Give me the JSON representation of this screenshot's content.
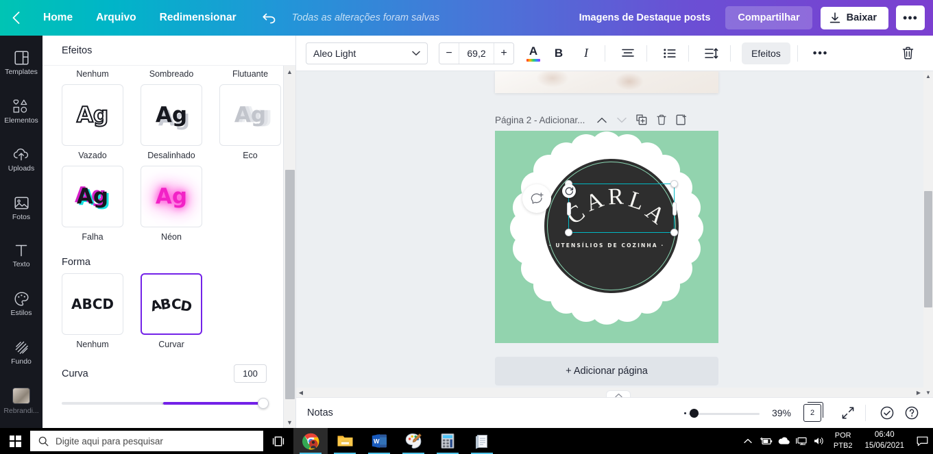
{
  "topbar": {
    "back_icon": "chevron-left-icon",
    "home": "Home",
    "arquivo": "Arquivo",
    "redimensionar": "Redimensionar",
    "undo_icon": "undo-arrow-icon",
    "save_status": "Todas as alterações foram salvas",
    "doc_name": "Imagens de Destaque posts",
    "share": "Compartilhar",
    "download": "Baixar",
    "download_icon": "download-icon",
    "more_icon": "ellipsis-icon",
    "more": "•••",
    "gradient_from": "#00c4b4",
    "gradient_to": "#7b3fd0"
  },
  "rail": {
    "items": [
      {
        "label": "Templates",
        "icon": "templates-icon"
      },
      {
        "label": "Elementos",
        "icon": "shapes-icon"
      },
      {
        "label": "Uploads",
        "icon": "cloud-upload-icon"
      },
      {
        "label": "Fotos",
        "icon": "photo-icon"
      },
      {
        "label": "Texto",
        "icon": "text-t-icon"
      },
      {
        "label": "Estilos",
        "icon": "palette-icon"
      },
      {
        "label": "Fundo",
        "icon": "background-hatch-icon"
      },
      {
        "label": "Rebrandi...",
        "icon": "brand-thumbnail-icon"
      }
    ]
  },
  "panel": {
    "title": "Efeitos",
    "top_captions": [
      "Nenhum",
      "Sombreado",
      "Flutuante"
    ],
    "effects_row1": [
      {
        "label": "Vazado",
        "sample": "Ag",
        "style": "vazado"
      },
      {
        "label": "Desalinhado",
        "sample": "Ag",
        "style": "desal"
      },
      {
        "label": "Eco",
        "sample": "Ag",
        "style": "eco"
      }
    ],
    "effects_row2": [
      {
        "label": "Falha",
        "sample": "Ag",
        "style": "falha"
      },
      {
        "label": "Néon",
        "sample": "Ag",
        "style": "neon"
      }
    ],
    "shape_title": "Forma",
    "shapes": [
      {
        "label": "Nenhum",
        "sample": "ABCD",
        "selected": false
      },
      {
        "label": "Curvar",
        "sample": "ABCD",
        "selected": true
      }
    ],
    "curve_label": "Curva",
    "curve_value": "100",
    "selected_shape": "Curvar",
    "accent_color": "#7322e8"
  },
  "toolbar": {
    "font_name": "Aleo Light",
    "font_dropdown_icon": "chevron-down-icon",
    "decrease": "−",
    "font_size": "69,2",
    "increase": "+",
    "text_color_icon": "text-color-A-icon",
    "text_color_glyph": "A",
    "bold": "B",
    "bold_icon": "bold-icon",
    "italic": "I",
    "italic_icon": "italic-icon",
    "align_icon": "text-align-icon",
    "list_icon": "bullet-list-icon",
    "spacing_icon": "line-spacing-icon",
    "effects_chip": "Efeitos",
    "more": "•••",
    "more_icon": "ellipsis-icon",
    "delete_icon": "trash-icon"
  },
  "canvas": {
    "page_title": "Página 2 - Adicionar...",
    "up_icon": "chevron-up-icon",
    "down_icon": "chevron-down-icon",
    "duplicate_icon": "duplicate-page-icon",
    "delete_icon": "trash-icon",
    "addpage_icon": "add-page-icon",
    "comment_icon": "add-comment-icon",
    "add_page": "+ Adicionar página",
    "background_color": "#92d3ae",
    "seal_color": "#2e2e2e",
    "logo": {
      "name": "CARLA",
      "letters": [
        "C",
        "A",
        "R",
        "L",
        "A"
      ],
      "tagline": "· UTENSÍLIOS DE COZINHA ·",
      "ring_color": "#8ad6b2"
    },
    "selection_color": "#00b8c4",
    "rotate_icon": "rotate-icon"
  },
  "statusbar": {
    "notes": "Notas",
    "collapse_icon": "chevron-up-icon",
    "zoom_percent": "39%",
    "page_count": "2",
    "pages_icon": "pages-icon",
    "fullscreen_icon": "expand-arrows-icon",
    "check_icon": "check-circle-icon",
    "help_icon": "help-circle-icon"
  },
  "taskbar": {
    "start_icon": "windows-start-icon",
    "search_icon": "search-icon",
    "search_placeholder": "Digite aqui para pesquisar",
    "taskview_icon": "task-view-icon",
    "apps": [
      {
        "name": "chrome-icon",
        "active": true
      },
      {
        "name": "file-explorer-icon",
        "active": false
      },
      {
        "name": "word-icon",
        "active": false
      },
      {
        "name": "paint-icon",
        "active": false
      },
      {
        "name": "calculator-icon",
        "active": false
      },
      {
        "name": "notepad-icon",
        "active": false
      }
    ],
    "tray": {
      "chevron_icon": "chevron-up-icon",
      "battery_icon": "battery-charging-icon",
      "cloud_icon": "onedrive-icon",
      "network_icon": "network-icon",
      "volume_icon": "volume-icon",
      "lang_line1": "POR",
      "lang_line2": "PTB2",
      "time": "06:40",
      "date": "15/06/2021",
      "action_center_icon": "action-center-icon"
    }
  }
}
